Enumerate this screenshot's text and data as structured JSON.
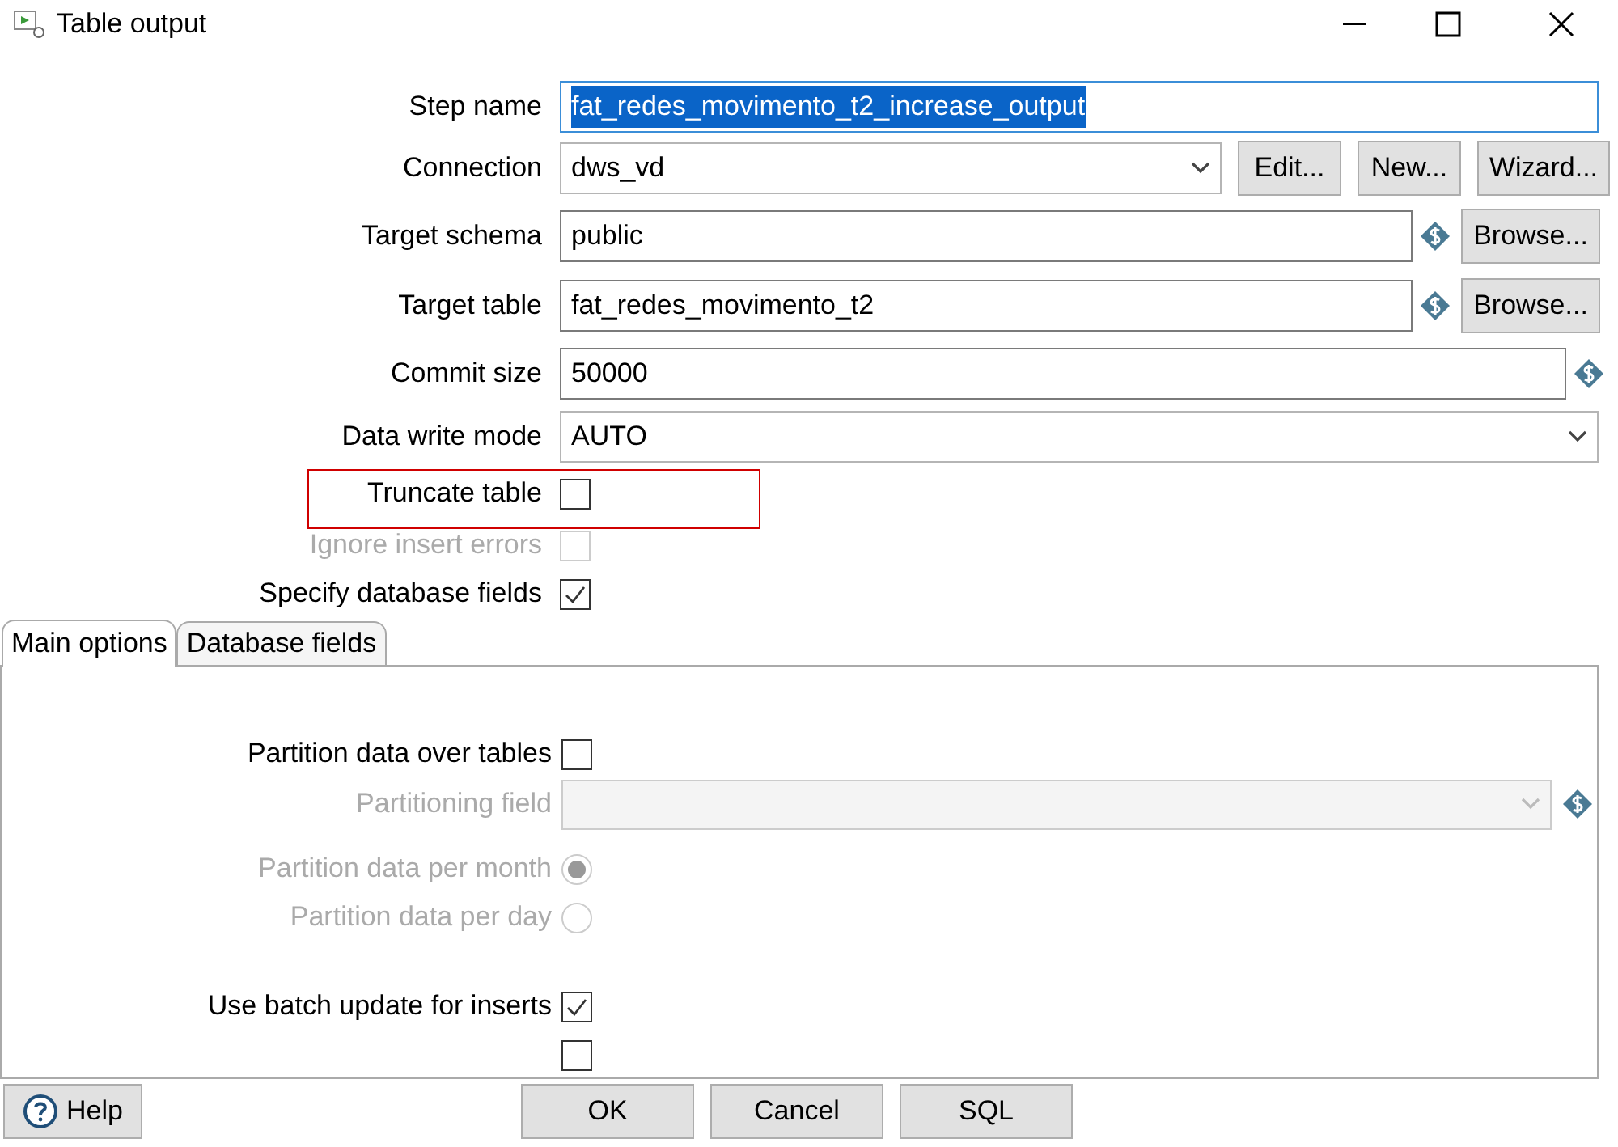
{
  "window": {
    "title": "Table output"
  },
  "fields": [
    {
      "kind": "text",
      "label": "Step name",
      "value": "fat_redes_movimento_t2_increase_output",
      "selected": true
    },
    {
      "kind": "combo",
      "label": "Connection",
      "value": "dws_vd",
      "buttons": [
        "Edit...",
        "New...",
        "Wizard..."
      ]
    },
    {
      "kind": "text",
      "label": "Target schema",
      "value": "public",
      "selected": false,
      "variable": true,
      "buttons": [
        "Browse..."
      ]
    },
    {
      "kind": "text",
      "label": "Target table",
      "value": "fat_redes_movimento_t2",
      "selected": false,
      "variable": true,
      "buttons": [
        "Browse..."
      ]
    },
    {
      "kind": "text",
      "label": "Commit size",
      "value": "50000",
      "selected": false,
      "variable": true
    },
    {
      "kind": "combo",
      "label": "Data write mode",
      "value": "AUTO"
    },
    {
      "kind": "checkbox",
      "label": "Truncate table",
      "checked": false,
      "disabled": false,
      "highlighted": true
    },
    {
      "kind": "checkbox",
      "label": "Ignore insert errors",
      "checked": false,
      "disabled": true,
      "highlighted": false
    },
    {
      "kind": "checkbox",
      "label": "Specify database fields",
      "checked": true,
      "disabled": false,
      "highlighted": false
    }
  ],
  "tabs": [
    {
      "label": "Main options",
      "selected": true
    },
    {
      "label": "Database fields",
      "selected": false
    }
  ],
  "panel_fields": [
    {
      "kind": "checkbox",
      "label": "Partition data over tables",
      "checked": false,
      "disabled": false
    },
    {
      "kind": "combo",
      "label": "Partitioning field",
      "disabled": true,
      "variable": true
    },
    {
      "kind": "radio",
      "label": "Partition data per month",
      "selected": true,
      "disabled": true
    },
    {
      "kind": "radio",
      "label": "Partition data per day",
      "selected": false,
      "disabled": true
    },
    {
      "kind": "spacer"
    },
    {
      "kind": "checkbox",
      "label": "Use batch update for inserts",
      "checked": true,
      "disabled": false
    },
    {
      "kind": "checkbox",
      "checked": false,
      "disabled": false
    }
  ],
  "footer": {
    "help": "Help",
    "buttons": [
      "OK",
      "Cancel",
      "SQL"
    ]
  }
}
